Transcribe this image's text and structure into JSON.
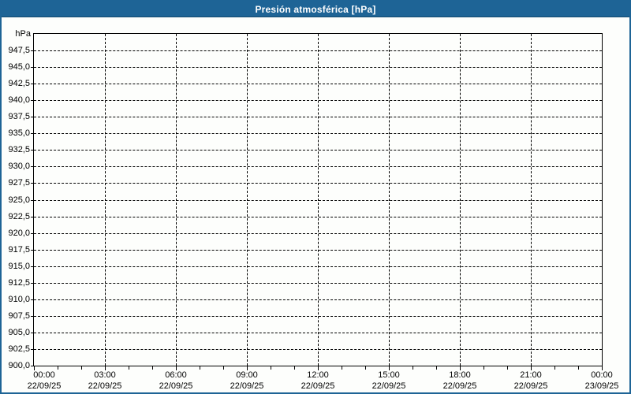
{
  "window": {
    "title": "Presión atmosférica [hPa]"
  },
  "colors": {
    "frame_border": "#1E6496",
    "titlebar_bg": "#1E6496",
    "titlebar_text": "#FFFFFF",
    "plot_background": "#FDFEFC",
    "axis_and_grid": "#000000",
    "tick_text": "#000000"
  },
  "chart_data": {
    "type": "line",
    "title": "Presión atmosférica [hPa]",
    "unit_label": "hPa",
    "ylabel": "hPa",
    "xlabel": "",
    "ylim": [
      900,
      950
    ],
    "ytick_step": 2.5,
    "yticks": [
      947.5,
      945.0,
      942.5,
      940.0,
      937.5,
      935.0,
      932.5,
      930.0,
      927.5,
      925.0,
      922.5,
      920.0,
      917.5,
      915.0,
      912.5,
      910.0,
      907.5,
      905.0,
      902.5,
      900.0
    ],
    "ytick_labels": [
      "947,5",
      "945,0",
      "942,5",
      "940,0",
      "937,5",
      "935,0",
      "932,5",
      "930,0",
      "927,5",
      "925,0",
      "922,5",
      "920,0",
      "917,5",
      "915,0",
      "912,5",
      "910,0",
      "907,5",
      "905,0",
      "902,5",
      "900,0"
    ],
    "xlim_hours": [
      0,
      24
    ],
    "xtick_minor_step_hours": 1,
    "xtick_major_step_hours": 3,
    "xticks": [
      {
        "hour": 0,
        "time": "00:00",
        "date": "22/09/25"
      },
      {
        "hour": 3,
        "time": "03:00",
        "date": "22/09/25"
      },
      {
        "hour": 6,
        "time": "06:00",
        "date": "22/09/25"
      },
      {
        "hour": 9,
        "time": "09:00",
        "date": "22/09/25"
      },
      {
        "hour": 12,
        "time": "12:00",
        "date": "22/09/25"
      },
      {
        "hour": 15,
        "time": "15:00",
        "date": "22/09/25"
      },
      {
        "hour": 18,
        "time": "18:00",
        "date": "22/09/25"
      },
      {
        "hour": 21,
        "time": "21:00",
        "date": "22/09/25"
      },
      {
        "hour": 24,
        "time": "00:00",
        "date": "23/09/25"
      }
    ],
    "grid": true,
    "legend": null,
    "series": []
  }
}
